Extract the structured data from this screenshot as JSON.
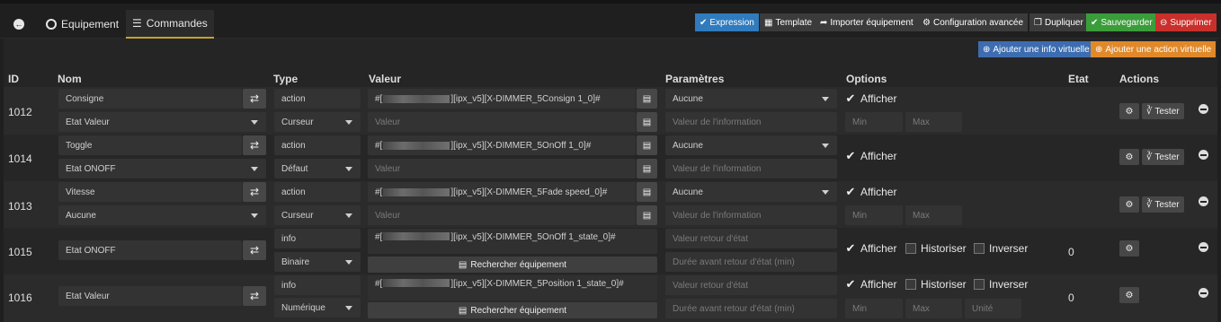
{
  "tabs": [
    {
      "label": "",
      "icon": "back-arrow-icon"
    },
    {
      "label": "Equipement",
      "icon": "gauge-icon"
    },
    {
      "label": "Commandes",
      "icon": "list-icon"
    }
  ],
  "header_buttons": {
    "expression": "Expression",
    "template": "Template",
    "importer": "Importer équipement",
    "config": "Configuration avancée",
    "dupliquer": "Dupliquer",
    "sauvegarder": "Sauvegarder",
    "supprimer": "Supprimer",
    "colors": {
      "expression": "#2f7bbd",
      "template": "#3b3b3b",
      "green": "#3a9d3a",
      "red": "#c9302c",
      "info_blue": "#3d6db0",
      "action_orange": "#e0892b"
    }
  },
  "add_buttons": {
    "info": "Ajouter une info virtuelle",
    "action": "Ajouter une action virtuelle"
  },
  "columns": {
    "id": "ID",
    "nom": "Nom",
    "type": "Type",
    "valeur": "Valeur",
    "parametres": "Paramètres",
    "options": "Options",
    "etat": "Etat",
    "actions": "Actions"
  },
  "common": {
    "afficher": "Afficher",
    "historiser": "Historiser",
    "inverser": "Inverser",
    "tester": "Tester",
    "rechercher": "Rechercher équipement",
    "min": "Min",
    "max": "Max",
    "unite": "Unité",
    "valeur_ph": "Valeur",
    "valeur_info_ph": "Valeur de l'information",
    "valeur_retour_ph": "Valeur retour d'état",
    "duree_ph": "Durée avant retour d'état (min)"
  },
  "rows": [
    {
      "id": "1012",
      "name": "Consigne",
      "sub": "Etat Valeur",
      "type": "action",
      "subtype": "Curseur",
      "value_prefix": "#[",
      "value_suffix": "][ipx_v5][X-DIMMER_5Consign 1_0]#",
      "param": "Aucune"
    },
    {
      "id": "1014",
      "name": "Toggle",
      "sub": "Etat ONOFF",
      "type": "action",
      "subtype": "Défaut",
      "value_prefix": "#[",
      "value_suffix": "][ipx_v5][X-DIMMER_5OnOff 1_0]#",
      "param": "Aucune"
    },
    {
      "id": "1013",
      "name": "Vitesse",
      "sub": "Aucune",
      "type": "action",
      "subtype": "Curseur",
      "value_prefix": "#[",
      "value_suffix": "][ipx_v5][X-DIMMER_5Fade speed_0]#",
      "param": "Aucune"
    },
    {
      "id": "1015",
      "name": "Etat ONOFF",
      "type": "info",
      "subtype": "Binaire",
      "value_prefix": "#[",
      "value_suffix": "][ipx_v5][X-DIMMER_5OnOff 1_state_0]#",
      "etat": "0"
    },
    {
      "id": "1016",
      "name": "Etat Valeur",
      "type": "info",
      "subtype": "Numérique",
      "value_prefix": "#[",
      "value_suffix": "][ipx_v5][X-DIMMER_5Position 1_state_0]#",
      "etat": "0"
    }
  ]
}
